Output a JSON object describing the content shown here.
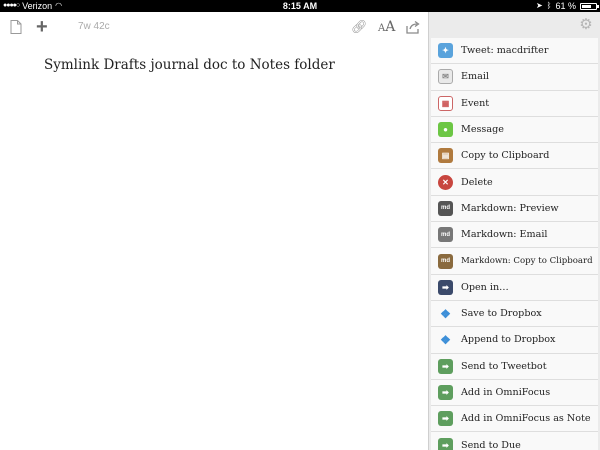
{
  "status_bar": {
    "carrier": "Verizon",
    "time": "8:15 AM",
    "battery": "61 %"
  },
  "editor": {
    "count": "7w 42c",
    "text": "Symlink Drafts journal doc to Notes folder"
  },
  "actions": [
    {
      "label": "Tweet: macdrifter",
      "icon": "twitter-icon",
      "color": "#5aa3dc"
    },
    {
      "label": "Email",
      "icon": "email-icon",
      "color": "#e9e9e9"
    },
    {
      "label": "Event",
      "icon": "calendar-icon",
      "color": "#ffffff"
    },
    {
      "label": "Message",
      "icon": "message-icon",
      "color": "#6cc644"
    },
    {
      "label": "Copy to Clipboard",
      "icon": "clipboard-icon",
      "color": "#b07a3e"
    },
    {
      "label": "Delete",
      "icon": "delete-icon",
      "color": "#c8463f"
    },
    {
      "label": "Markdown: Preview",
      "icon": "markdown-icon",
      "color": "#555555"
    },
    {
      "label": "Markdown: Email",
      "icon": "markdown-email-icon",
      "color": "#777777"
    },
    {
      "label": "Markdown: Copy to Clipboard",
      "icon": "markdown-clipboard-icon",
      "color": "#8a6a3e"
    },
    {
      "label": "Open in…",
      "icon": "arrow-icon",
      "color": "#3b4a6b"
    },
    {
      "label": "Save to Dropbox",
      "icon": "dropbox-icon",
      "color": "#3d8fd8"
    },
    {
      "label": "Append to Dropbox",
      "icon": "dropbox-icon",
      "color": "#3d8fd8"
    },
    {
      "label": "Send to Tweetbot",
      "icon": "arrow-icon",
      "color": "#5e9e5e"
    },
    {
      "label": "Add in OmniFocus",
      "icon": "arrow-icon",
      "color": "#5e9e5e"
    },
    {
      "label": "Add in OmniFocus as Note",
      "icon": "arrow-icon",
      "color": "#5e9e5e"
    },
    {
      "label": "Send to Due",
      "icon": "arrow-icon",
      "color": "#5e9e5e"
    }
  ]
}
